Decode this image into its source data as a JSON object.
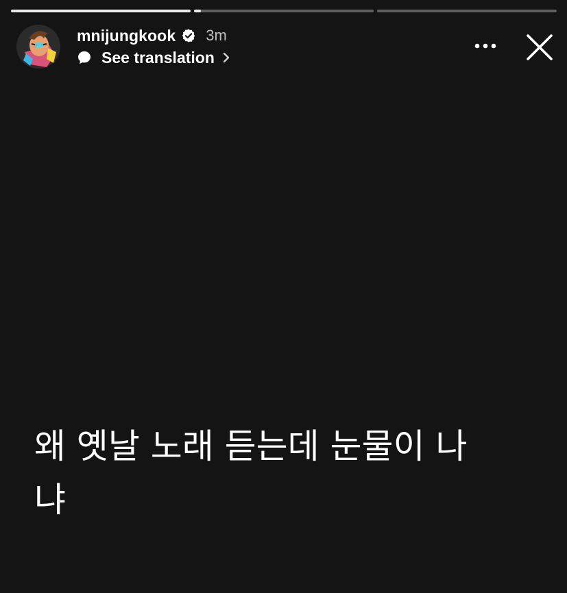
{
  "story": {
    "progress": [
      {
        "filled": 1.0
      },
      {
        "filled": 0.04
      },
      {
        "filled": 0.0
      }
    ],
    "user": {
      "username": "mnijungkook",
      "verified": true,
      "time_ago": "3m",
      "avatar_icon": "avatar-illustration"
    },
    "translation": {
      "label": "See translation",
      "icon": "chat-bubble-icon"
    },
    "controls": {
      "more_icon": "more-horizontal-icon",
      "close_icon": "close-icon"
    },
    "text_lines": [
      "왜 옛날 노래 듣는데 눈물이 나",
      "냐"
    ]
  },
  "colors": {
    "background": "#141414",
    "text": "#ffffff",
    "progress_track": "rgba(255,255,255,0.32)",
    "progress_fill": "#e9e9e9"
  }
}
